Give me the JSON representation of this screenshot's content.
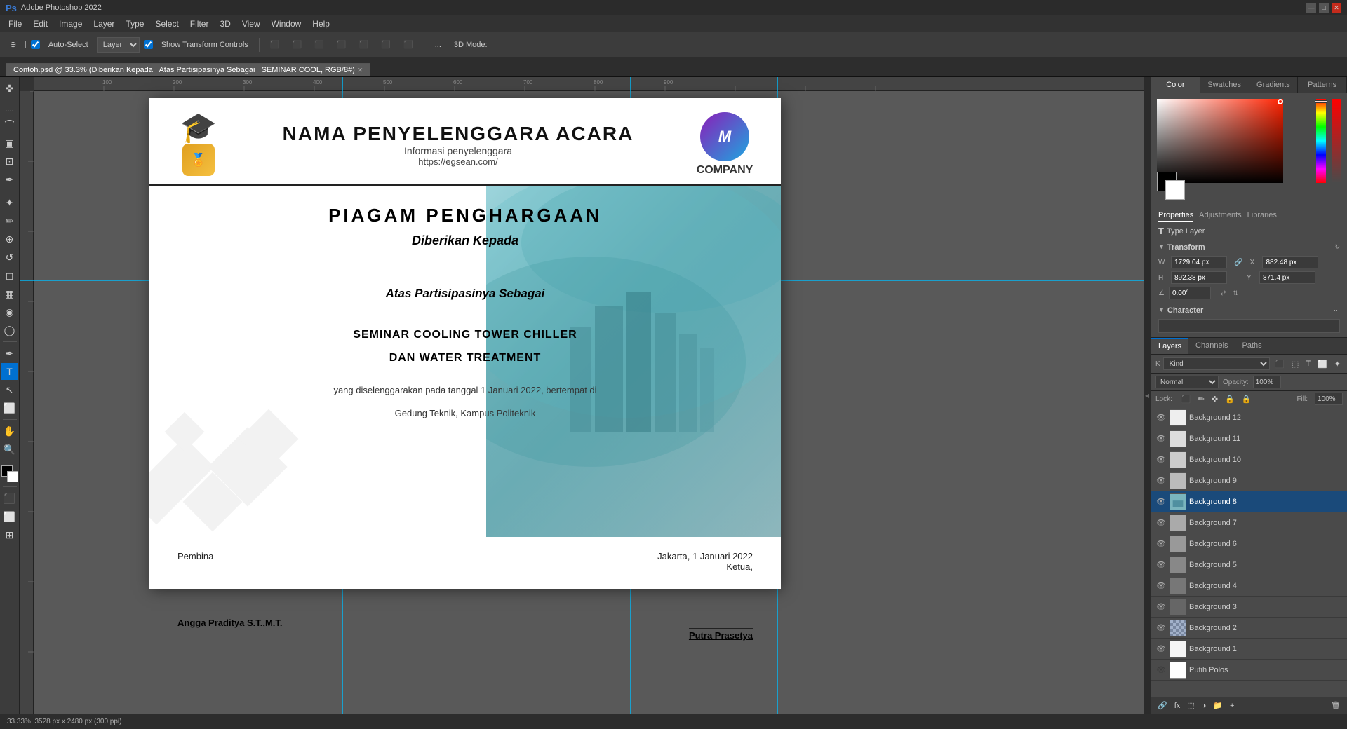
{
  "titlebar": {
    "title": "Adobe Photoshop 2022",
    "minimize": "—",
    "maximize": "□",
    "close": "✕"
  },
  "menubar": {
    "items": [
      "File",
      "Edit",
      "Image",
      "Layer",
      "Type",
      "Select",
      "Filter",
      "3D",
      "View",
      "Window",
      "Help"
    ]
  },
  "toolbar": {
    "auto_select_label": "Auto-Select",
    "layer_label": "Layer",
    "transform_label": "Show Transform Controls",
    "threeD_label": "3D Mode:",
    "more_label": "..."
  },
  "tabs": {
    "tab1": "Contoh.psd @ 33.3% (Diberikan Kepada",
    "tab2": "Atas Partisipasinya Sebagai",
    "tab3": "SEMINAR COOL, RGB/8#) *"
  },
  "certificate": {
    "org_name": "NAMA PENYELENGGARA ACARA",
    "org_info": "Informasi penyelenggara",
    "org_url": "https://egsean.com/",
    "company_label": "COMPANY",
    "piagam": "PIAGAM PENGHARGAAN",
    "diberikan": "Diberikan Kepada",
    "atas": "Atas Partisipasinya Sebagai",
    "seminar_line1": "SEMINAR COOLING TOWER CHILLER",
    "seminar_line2": "DAN WATER TREATMENT",
    "yang": "yang diselenggarakan pada tanggal 1 Januari 2022, bertempat di",
    "gedung": "Gedung Teknik, Kampus Politeknik",
    "location_date": "Jakarta, 1 Januari 2022",
    "ketua": "Ketua,",
    "pembina_label": "Pembina",
    "pembina_name": "Angga Praditya S.T.,M.T.",
    "ketua_name": "Putra Prasetya"
  },
  "color_panel": {
    "tab_color": "Color",
    "tab_swatches": "Swatches",
    "tab_gradients": "Gradients",
    "tab_patterns": "Patterns"
  },
  "properties_panel": {
    "tab_properties": "Properties",
    "tab_adjustments": "Adjustments",
    "tab_libraries": "Libraries",
    "type_layer_label": "Type Layer",
    "transform_label": "Transform",
    "W_label": "W",
    "W_value": "1729.04 px",
    "X_label": "X",
    "X_value": "882.48 px",
    "H_label": "H",
    "H_value": "892.38 px",
    "Y_label": "Y",
    "Y_value": "871.4 px",
    "angle_value": "0.00°",
    "character_label": "Character"
  },
  "layers_panel": {
    "tab_layers": "Layers",
    "tab_channels": "Channels",
    "tab_paths": "Paths",
    "search_placeholder": "Kind",
    "mode": "Normal",
    "opacity_label": "Opacity:",
    "opacity_value": "100%",
    "lock_label": "Lock:",
    "fill_label": "Fill:",
    "fill_value": "100%",
    "layers": [
      {
        "name": "Background 12",
        "visible": true,
        "selected": false,
        "type": "normal"
      },
      {
        "name": "Background 11",
        "visible": true,
        "selected": false,
        "type": "normal"
      },
      {
        "name": "Background 10",
        "visible": true,
        "selected": false,
        "type": "normal"
      },
      {
        "name": "Background 9",
        "visible": true,
        "selected": false,
        "type": "normal"
      },
      {
        "name": "Background 8",
        "visible": true,
        "selected": true,
        "type": "image"
      },
      {
        "name": "Background 7",
        "visible": true,
        "selected": false,
        "type": "normal"
      },
      {
        "name": "Background 6",
        "visible": true,
        "selected": false,
        "type": "normal"
      },
      {
        "name": "Background 5",
        "visible": true,
        "selected": false,
        "type": "normal"
      },
      {
        "name": "Background 4",
        "visible": true,
        "selected": false,
        "type": "normal"
      },
      {
        "name": "Background 3",
        "visible": true,
        "selected": false,
        "type": "normal"
      },
      {
        "name": "Background 2",
        "visible": true,
        "selected": false,
        "type": "image2"
      },
      {
        "name": "Background 1",
        "visible": true,
        "selected": false,
        "type": "normal"
      },
      {
        "name": "Putih Polos",
        "visible": false,
        "selected": false,
        "type": "normal"
      }
    ]
  },
  "statusbar": {
    "zoom": "33.33%",
    "dimensions": "3528 px x 2480 px (300 ppi)"
  }
}
